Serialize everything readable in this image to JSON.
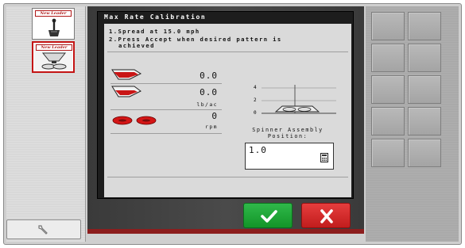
{
  "left_panel": {
    "app_buttons": [
      {
        "logo_text": "New Leader",
        "icon": "joystick-icon"
      },
      {
        "logo_text": "New Leader",
        "icon": "spreader-icon"
      }
    ],
    "settings_icon": "wrench-icon"
  },
  "dialog": {
    "title": "Max Rate Calibration",
    "instructions": {
      "step1": "1.Spread at 15.0 mph",
      "step2_line1": "2.Press Accept when desired pattern is",
      "step2_line2": "achieved"
    },
    "readings": {
      "row1_value": "0.0",
      "row2_value": "0.0",
      "row2_unit": "lb/ac",
      "row3_value": "0",
      "row3_unit": "rpm"
    },
    "graph": {
      "y_ticks": [
        "4",
        "2",
        "0"
      ]
    },
    "spinner_label": "Spinner Assembly Position:",
    "spinner_value": "1.0"
  },
  "buttons": {
    "accept_icon": "checkmark-icon",
    "cancel_icon": "x-icon"
  },
  "colors": {
    "accept": "#1aa334",
    "cancel": "#d12727",
    "brand_red": "#b01818",
    "dialog_header": "#1d1d1d"
  }
}
